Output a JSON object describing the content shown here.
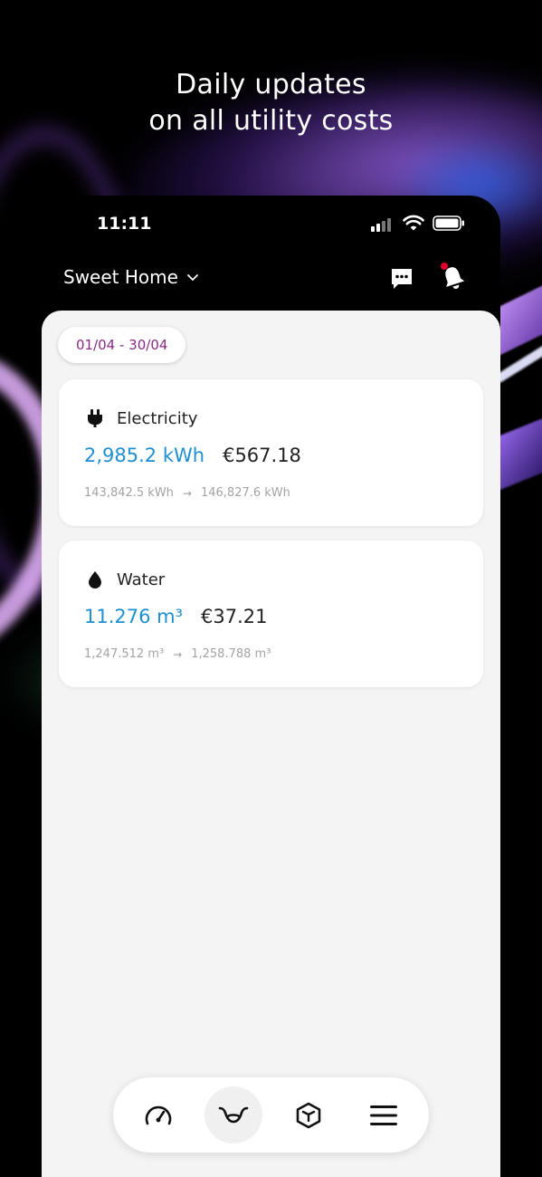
{
  "headline": {
    "line1": "Daily updates",
    "line2": "on all utility costs"
  },
  "status_bar": {
    "time": "11:11"
  },
  "header": {
    "home_name": "Sweet Home",
    "icons": [
      "chevron-down-icon",
      "chat-icon",
      "bell-icon"
    ],
    "notification_dot_color": "#e0002a"
  },
  "period": {
    "label": "01/04 - 30/04"
  },
  "utilities": [
    {
      "name": "Electricity",
      "icon": "plug-icon",
      "usage": "2,985.2 kWh",
      "cost": "€567.18",
      "start_reading": "143,842.5 kWh",
      "end_reading": "146,827.6 kWh"
    },
    {
      "name": "Water",
      "icon": "water-drop-icon",
      "usage": "11.276 m³",
      "cost": "€37.21",
      "start_reading": "1,247.512 m³",
      "end_reading": "1,258.788 m³"
    }
  ],
  "tab_bar": {
    "tabs": [
      {
        "icon": "speedometer-icon",
        "active": false
      },
      {
        "icon": "utility-meter-icon",
        "active": true
      },
      {
        "icon": "box-icon",
        "active": false
      },
      {
        "icon": "menu-icon",
        "active": false
      }
    ]
  },
  "colors": {
    "usage_blue": "#1e8fd0",
    "date_text": "#8a2a86",
    "sheet_bg": "#f4f4f4"
  }
}
